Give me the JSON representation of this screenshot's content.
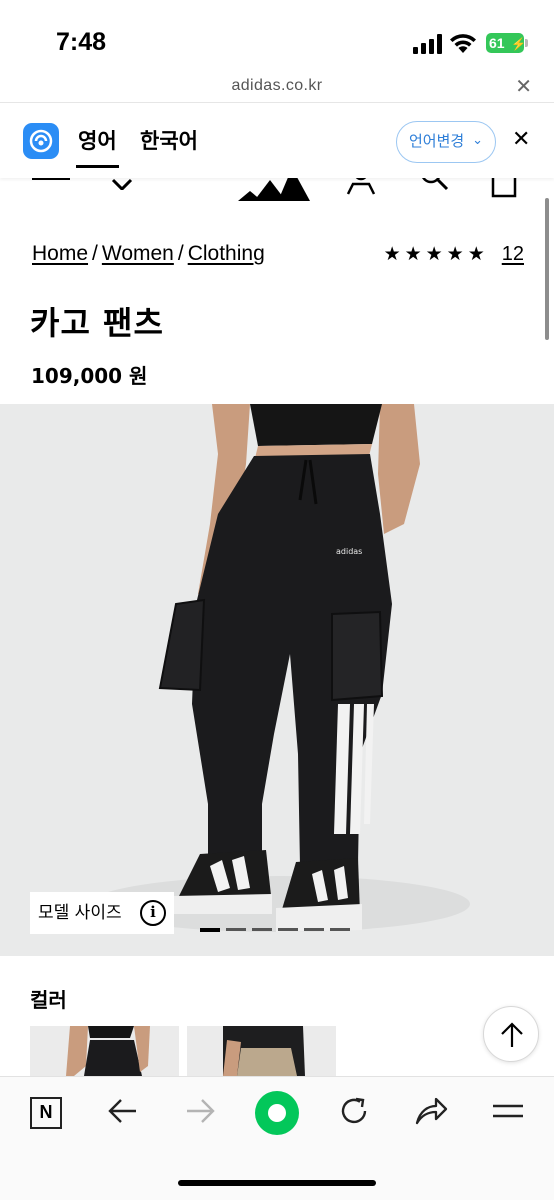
{
  "status_bar": {
    "time": "7:48",
    "battery": "61"
  },
  "browser": {
    "url": "adidas.co.kr"
  },
  "translate_bar": {
    "source_lang": "영어",
    "target_lang": "한국어",
    "change_lang_label": "언어변경"
  },
  "breadcrumb": {
    "items": [
      "Home",
      "Women",
      "Clothing"
    ],
    "separator": "/"
  },
  "rating": {
    "stars": "★★★★★",
    "review_count": "12"
  },
  "product": {
    "title": "카고 팬츠",
    "price": "109,000 원"
  },
  "gallery": {
    "model_size_label": "모델 사이즈",
    "info_symbol": "i",
    "slide_count": 6,
    "active_slide": 1
  },
  "color_section": {
    "label": "컬러"
  },
  "colors": {
    "accent_blue": "#2f7fd8",
    "naver_green": "#03c75a",
    "battery_green": "#34c759"
  }
}
